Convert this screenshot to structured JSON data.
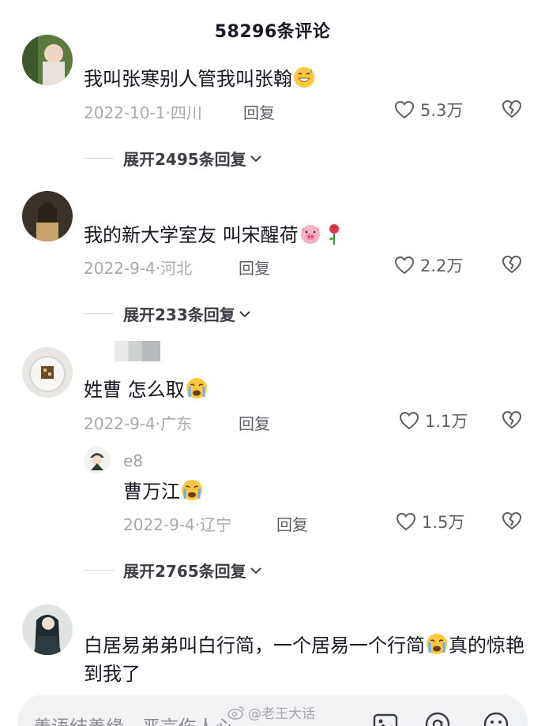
{
  "header": {
    "title": "58296条评论"
  },
  "comments": [
    {
      "text": "我叫张寒别人管我叫张翰",
      "emoji": "grinning-sweat-emoji",
      "date": "2022-10-1",
      "region": "四川",
      "reply_label": "回复",
      "likes": "5.3万",
      "expand": "展开2495条回复"
    },
    {
      "text": "我的新大学室友 叫宋醒荷",
      "emoji": "pig-face-emoji",
      "emoji2": "rose-emoji",
      "date": "2022-9-4",
      "region": "河北",
      "reply_label": "回复",
      "likes": "2.2万",
      "expand": "展开233条回复"
    },
    {
      "text": "姓曹 怎么取",
      "emoji": "crying-face-emoji",
      "date": "2022-9-4",
      "region": "广东",
      "reply_label": "回复",
      "likes": "1.1万",
      "reply": {
        "username": "e8",
        "text": "曹万江",
        "emoji": "crying-face-emoji",
        "date": "2022-9-4",
        "region": "辽宁",
        "reply_label": "回复",
        "likes": "1.5万"
      },
      "expand": "展开2765条回复"
    },
    {
      "text": "白居易弟弟叫白行简，一个居易一个行简",
      "text_tail": "真的惊艳到我了",
      "emoji": "crying-face-emoji"
    }
  ],
  "bottom": {
    "placeholder": "善语结善缘，恶言伤人心",
    "watermark": "@老王大话"
  },
  "colors": {
    "text": "#161823",
    "meta": "#a8a9ad",
    "accent_bar": "#f1f2f4"
  }
}
